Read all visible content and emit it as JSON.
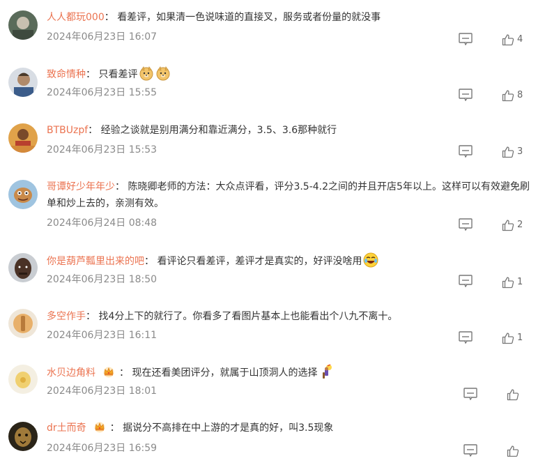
{
  "comments": [
    {
      "username": "人人都玩000",
      "text": "看差评，如果清一色说味道的直接叉，服务或者份量的就没事",
      "date": "2024年06月23日 16:07",
      "likes": "4"
    },
    {
      "username": "致命情种",
      "text": "只看差评",
      "date": "2024年06月23日 15:55",
      "likes": "8",
      "emoji": "doge-emoji"
    },
    {
      "username": "BTBUzpf",
      "text": "经验之谈就是别用满分和靠近满分，3.5、3.6那种就行",
      "date": "2024年06月23日 15:53",
      "likes": "3"
    },
    {
      "username": "哥谭好少年年少",
      "text": "陈晓卿老师的方法：大众点评看，评分3.5-4.2之间的并且开店5年以上。这样可以有效避免刷单和炒上去的，亲测有效。",
      "date": "2024年06月24日 08:48",
      "likes": "2"
    },
    {
      "username": "你是葫芦瓢里出来的吧",
      "text": "看评论只看差评，差评才是真实的，好评没啥用",
      "date": "2024年06月23日 18:50",
      "likes": "1",
      "emoji": "laugh-cry-emoji"
    },
    {
      "username": "多空作手",
      "text": "找4分上下的就行了。你看多了看图片基本上也能看出个八九不离十。",
      "date": "2024年06月23日 16:11",
      "likes": "1"
    },
    {
      "username": "水贝边角料",
      "text": "现在还看美团评分，就属于山顶洞人的选择",
      "date": "2024年06月23日 18:01",
      "likes": "",
      "badge": "crown-badge",
      "emoji": "caveman-emoji"
    },
    {
      "username": "dr土而奇",
      "text": "据说分不高排在中上游的才是真的好，叫3.5现象",
      "date": "2024年06月23日 16:59",
      "likes": "",
      "badge": "crown-badge"
    }
  ],
  "colors": {
    "username": "#eb7350",
    "text": "#333333",
    "date": "#8a8a8a",
    "icon": "#777777"
  }
}
